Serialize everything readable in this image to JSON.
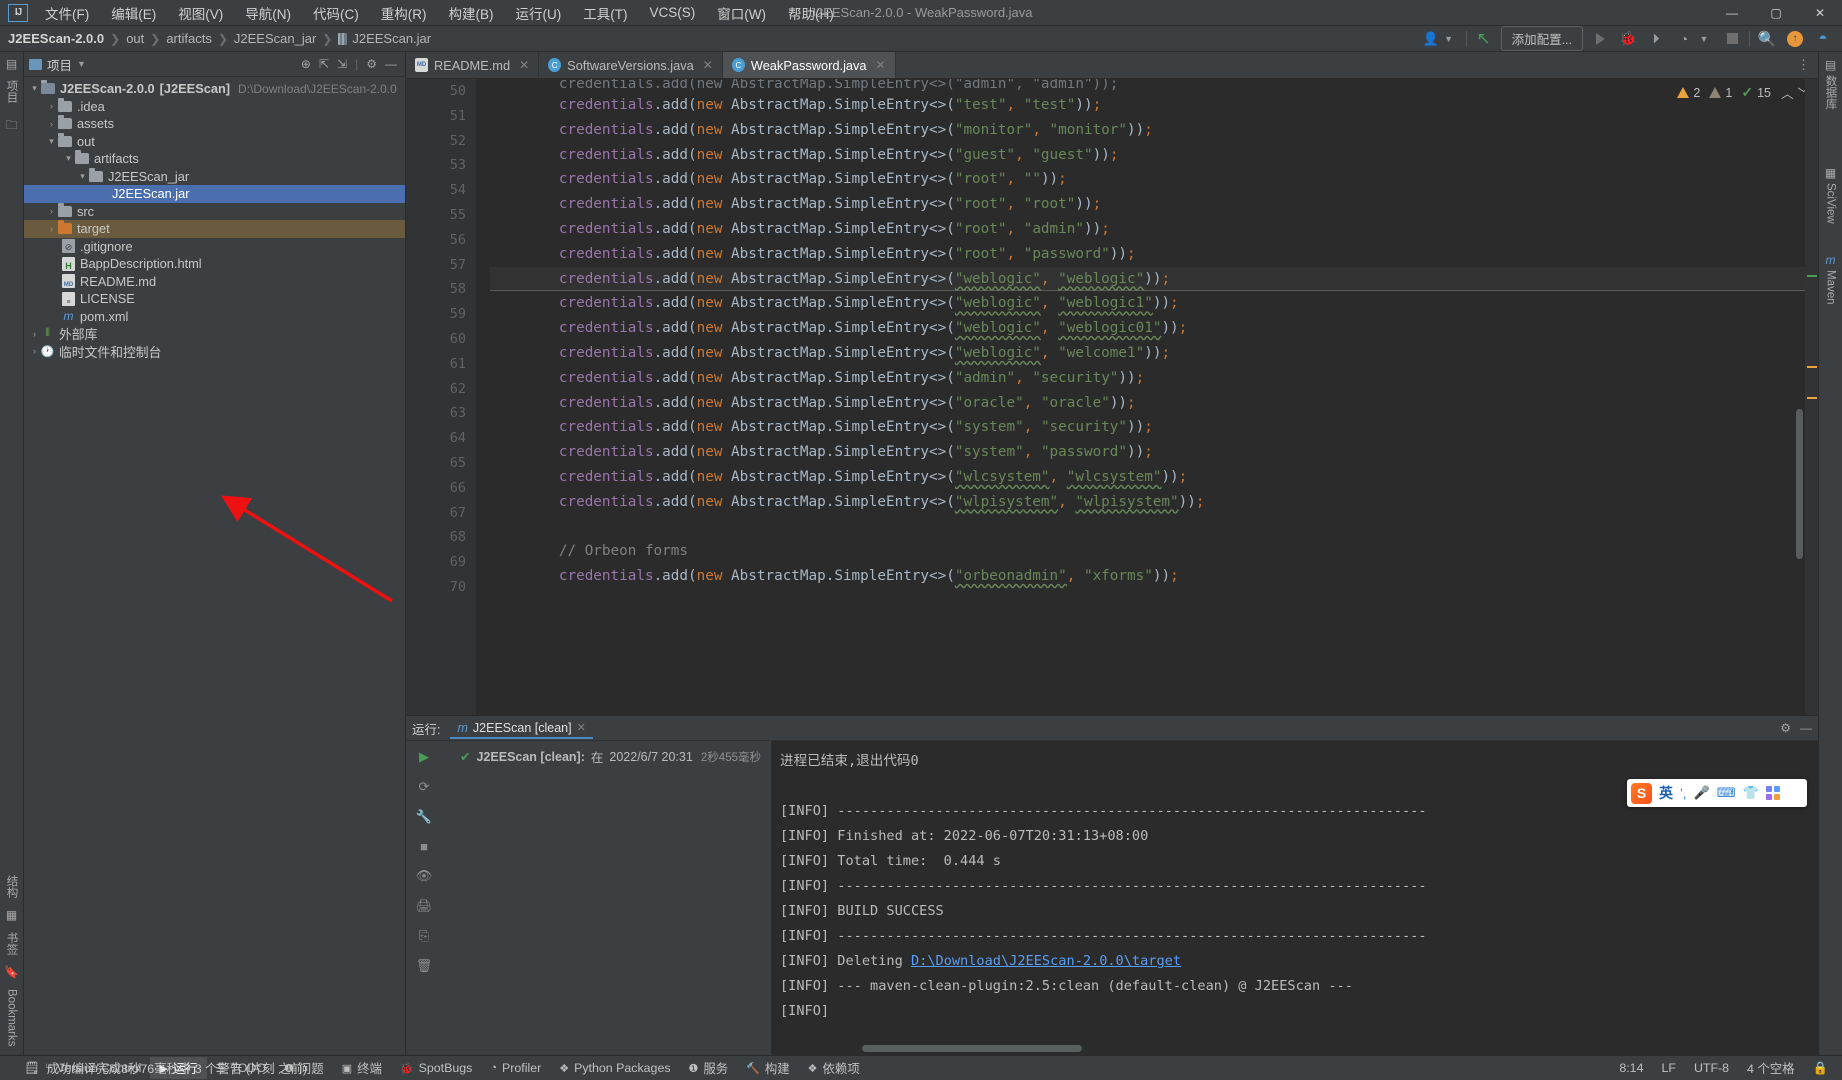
{
  "titlebar": {
    "logo": "IJ",
    "window_title": "J2EEScan-2.0.0 - WeakPassword.java",
    "menus": [
      {
        "label": "文件(F)"
      },
      {
        "label": "编辑(E)"
      },
      {
        "label": "视图(V)"
      },
      {
        "label": "导航(N)"
      },
      {
        "label": "代码(C)"
      },
      {
        "label": "重构(R)"
      },
      {
        "label": "构建(B)"
      },
      {
        "label": "运行(U)"
      },
      {
        "label": "工具(T)"
      },
      {
        "label": "VCS(S)"
      },
      {
        "label": "窗口(W)"
      },
      {
        "label": "帮助(H)"
      }
    ],
    "minimize": "—",
    "maximize": "▢",
    "close": "✕"
  },
  "navbar": {
    "breadcrumb": [
      "J2EEScan-2.0.0",
      "out",
      "artifacts",
      "J2EEScan_jar",
      "J2EEScan.jar"
    ],
    "add_config_label": "添加配置...",
    "icons": [
      "user-icon",
      "chevron-down-icon",
      "update-project-icon",
      "run-icon",
      "debug-icon",
      "run-coverage-icon",
      "profile-icon",
      "stop-icon",
      "search-icon",
      "notification-icon",
      "ide-icon"
    ]
  },
  "left_rail": {
    "top": [
      "项目",
      "收藏夹"
    ],
    "bottom": [
      "结构",
      "书签",
      "Bookmarks"
    ]
  },
  "project_panel": {
    "title": "项目",
    "header_icons": [
      "locate-icon",
      "expand-all-icon",
      "collapse-all-icon",
      "gear-icon",
      "hide-icon"
    ],
    "tree": [
      {
        "label": "J2EEScan-2.0.0",
        "badge": "[J2EEScan]",
        "path": "D:\\Download\\J2EEScan-2.0.0",
        "depth": 0,
        "arrow": "▾",
        "type": "module",
        "sel": false
      },
      {
        "label": ".idea",
        "depth": 1,
        "arrow": "›",
        "type": "folder",
        "sel": false
      },
      {
        "label": "assets",
        "depth": 1,
        "arrow": "›",
        "type": "folder",
        "sel": false
      },
      {
        "label": "out",
        "depth": 1,
        "arrow": "▾",
        "type": "folder",
        "sel": false
      },
      {
        "label": "artifacts",
        "depth": 2,
        "arrow": "▾",
        "type": "folder",
        "sel": false
      },
      {
        "label": "J2EEScan_jar",
        "depth": 3,
        "arrow": "▾",
        "type": "folder",
        "sel": false
      },
      {
        "label": "J2EEScan.jar",
        "depth": 4,
        "arrow": "",
        "type": "jar",
        "sel": true
      },
      {
        "label": "src",
        "depth": 1,
        "arrow": "›",
        "type": "folder",
        "sel": false
      },
      {
        "label": "target",
        "depth": 1,
        "arrow": "›",
        "type": "folder-orange",
        "sel": false,
        "hl": true
      },
      {
        "label": ".gitignore",
        "depth": 2,
        "arrow": "",
        "type": "gitignore",
        "sel": false
      },
      {
        "label": "BappDescription.html",
        "depth": 2,
        "arrow": "",
        "type": "html",
        "sel": false
      },
      {
        "label": "README.md",
        "depth": 2,
        "arrow": "",
        "type": "md",
        "sel": false
      },
      {
        "label": "LICENSE",
        "depth": 2,
        "arrow": "",
        "type": "txt",
        "sel": false
      },
      {
        "label": "pom.xml",
        "depth": 2,
        "arrow": "",
        "type": "maven",
        "sel": false
      },
      {
        "label": "外部库",
        "depth": 0,
        "arrow": "›",
        "type": "library",
        "sel": false
      },
      {
        "label": "临时文件和控制台",
        "depth": 0,
        "arrow": "›",
        "type": "scratch",
        "sel": false
      }
    ]
  },
  "editor": {
    "tabs": [
      {
        "label": "README.md",
        "icon": "md",
        "active": false
      },
      {
        "label": "SoftwareVersions.java",
        "icon": "class",
        "active": false
      },
      {
        "label": "WeakPassword.java",
        "icon": "class",
        "active": true
      }
    ],
    "inspection": {
      "warnings": "2",
      "weak_warnings": "1",
      "checks": "15"
    },
    "first_visible_line": 50,
    "lines": [
      {
        "n": 50,
        "partial": true,
        "text": "credentials.add(new AbstractMap.SimpleEntry<>(\"admin\", \"admin\"));"
      },
      {
        "n": 51,
        "user": "test",
        "pass": "test"
      },
      {
        "n": 52,
        "user": "monitor",
        "pass": "monitor"
      },
      {
        "n": 53,
        "user": "guest",
        "pass": "guest"
      },
      {
        "n": 54,
        "user": "root",
        "pass": ""
      },
      {
        "n": 55,
        "user": "root",
        "pass": "root"
      },
      {
        "n": 56,
        "user": "root",
        "pass": "admin"
      },
      {
        "n": 57,
        "user": "root",
        "pass": "password"
      },
      {
        "n": 58,
        "user": "weblogic",
        "pass": "weblogic",
        "squiggle": "both",
        "caretline": true
      },
      {
        "n": 59,
        "user": "weblogic",
        "pass": "weblogic1",
        "squiggle": "both"
      },
      {
        "n": 60,
        "user": "weblogic",
        "pass": "weblogic01",
        "squiggle": "both"
      },
      {
        "n": 61,
        "user": "weblogic",
        "pass": "welcome1",
        "squiggle": "user"
      },
      {
        "n": 62,
        "user": "admin",
        "pass": "security"
      },
      {
        "n": 63,
        "user": "oracle",
        "pass": "oracle"
      },
      {
        "n": 64,
        "user": "system",
        "pass": "security"
      },
      {
        "n": 65,
        "user": "system",
        "pass": "password"
      },
      {
        "n": 66,
        "user": "wlcsystem",
        "pass": "wlcsystem",
        "squiggle": "both"
      },
      {
        "n": 67,
        "user": "wlpisystem",
        "pass": "wlpisystem",
        "squiggle": "both"
      },
      {
        "n": 68,
        "blank": true
      },
      {
        "n": 69,
        "comment": "// Orbeon forms"
      },
      {
        "n": 70,
        "user": "orbeonadmin",
        "pass": "xforms",
        "squiggle": "user"
      }
    ],
    "code_prefix": "credentials.add(new AbstractMap.SimpleEntry<>(",
    "code_suffix": "));"
  },
  "right_rail": {
    "items": [
      {
        "label": "数据库",
        "icon": "database-icon"
      },
      {
        "label": "SciView",
        "icon": "grid-icon"
      },
      {
        "label": "Maven",
        "icon": "maven-icon"
      }
    ]
  },
  "run_panel": {
    "label": "运行:",
    "tab_label": "J2EEScan [clean]",
    "tab_icon": "maven-icon",
    "tree_item": "J2EEScan [clean]:",
    "tree_prefix": "在",
    "tree_time": "2022/6/7 20:31",
    "duration": "2秒455毫秒",
    "toolbar_icons": [
      "rerun-icon",
      "rerun-failed-icon",
      "settings-wrench-icon",
      "stop-icon",
      "eye-icon",
      "print-icon",
      "export-icon",
      "trash-icon"
    ],
    "right_icons": [
      "gear-icon",
      "hide-icon"
    ],
    "console_lines": [
      {
        "t": "[INFO] "
      },
      {
        "t": "[INFO] --- maven-clean-plugin:2.5:clean (default-clean) @ J2EEScan ---"
      },
      {
        "t": "[INFO] Deleting ",
        "link": "D:\\Download\\J2EEScan-2.0.0\\target"
      },
      {
        "t": "[INFO] ------------------------------------------------------------------------"
      },
      {
        "t": "[INFO] BUILD SUCCESS"
      },
      {
        "t": "[INFO] ------------------------------------------------------------------------"
      },
      {
        "t": "[INFO] Total time:  0.444 s"
      },
      {
        "t": "[INFO] Finished at: 2022-06-07T20:31:13+08:00"
      },
      {
        "t": "[INFO] ------------------------------------------------------------------------"
      },
      {
        "t": ""
      },
      {
        "t": "进程已结束,退出代码0"
      }
    ]
  },
  "statusbar": {
    "items": [
      {
        "label": "Version Control",
        "icon": "branch-icon",
        "active": false
      },
      {
        "label": "运行",
        "icon": "play-icon",
        "active": true
      },
      {
        "label": "TODO",
        "icon": "list-icon",
        "active": false
      },
      {
        "label": "问题",
        "icon": "problems-icon",
        "active": false
      },
      {
        "label": "终端",
        "icon": "terminal-icon",
        "active": false
      },
      {
        "label": "SpotBugs",
        "icon": "bug-icon",
        "active": false
      },
      {
        "label": "Profiler",
        "icon": "profiler-icon",
        "active": false
      },
      {
        "label": "Python Packages",
        "icon": "packages-icon",
        "active": false
      },
      {
        "label": "服务",
        "icon": "services-icon",
        "active": false
      },
      {
        "label": "构建",
        "icon": "hammer-icon",
        "active": false
      },
      {
        "label": "依赖项",
        "icon": "dependencies-icon",
        "active": false
      }
    ],
    "message": "成功编译完成8秒76毫秒中 3 个警告 (片刻 之前)",
    "caret_position": "8:14",
    "line_separator": "LF",
    "encoding": "UTF-8",
    "indent": "4 个空格",
    "lock_icon": "lock-icon"
  },
  "ime": {
    "logo": "S",
    "mode": "英",
    "icons": [
      "comma-icon",
      "mic-icon",
      "keyboard-icon",
      "skin-icon",
      "apps-icon"
    ]
  },
  "colors": {
    "accent_blue": "#4b6eaf",
    "keyword_orange": "#cc7832",
    "string_green": "#6a8759",
    "field_purple": "#9876aa",
    "text_grey": "#a9b7c6",
    "link_blue": "#589df6",
    "panel_bg": "#3c3f41",
    "editor_bg": "#2b2b2b"
  }
}
